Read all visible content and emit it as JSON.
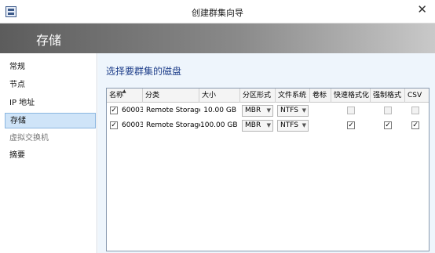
{
  "window": {
    "title": "创建群集向导"
  },
  "banner": {
    "title": "存储"
  },
  "sidebar": {
    "items": [
      {
        "label": "常规",
        "state": "normal"
      },
      {
        "label": "节点",
        "state": "normal"
      },
      {
        "label": "IP 地址",
        "state": "normal"
      },
      {
        "label": "存储",
        "state": "active"
      },
      {
        "label": "虚拟交换机",
        "state": "disabled"
      },
      {
        "label": "摘要",
        "state": "normal"
      }
    ]
  },
  "main": {
    "heading": "选择要群集的磁盘",
    "table": {
      "columns": [
        "名称",
        "分类",
        "大小",
        "分区形式",
        "文件系统",
        "卷标",
        "快速格式化",
        "强制格式",
        "CSV"
      ],
      "rows": [
        {
          "selected": true,
          "name": "60003",
          "category": "Remote Storage",
          "size": "10.00 GB",
          "partition": "MBR",
          "filesystem": "NTFS",
          "label": "",
          "quick_format": false,
          "force_format": false,
          "csv": false
        },
        {
          "selected": true,
          "name": "60003",
          "category": "Remote Storage",
          "size": "100.00 GB",
          "partition": "MBR",
          "filesystem": "NTFS",
          "label": "",
          "quick_format": true,
          "force_format": true,
          "csv": true
        }
      ]
    }
  },
  "colors": {
    "accent": "#1f3f8a",
    "selection": "#cfe4f8",
    "banner_dark": "#5c5c5c"
  }
}
